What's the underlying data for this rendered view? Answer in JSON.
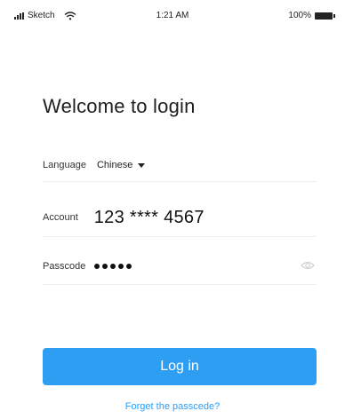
{
  "status_bar": {
    "carrier": "Sketch",
    "time": "1:21 AM",
    "battery": "100%",
    "signal_icon": "signal-bars-icon",
    "wifi_icon": "wifi-icon",
    "battery_icon": "battery-icon"
  },
  "title": "Welcome to login",
  "language": {
    "label": "Language",
    "value": "Chinese"
  },
  "account": {
    "label": "Account",
    "value": "123 **** 4567"
  },
  "passcode": {
    "label": "Passcode",
    "masked_length": 5,
    "toggle_icon": "eye-icon"
  },
  "login_button": {
    "label": "Log in"
  },
  "forgot_link": {
    "label": "Forget the passcede?"
  },
  "colors": {
    "accent": "#2e9ef3",
    "text": "#222222",
    "divider": "#eeeeee"
  }
}
